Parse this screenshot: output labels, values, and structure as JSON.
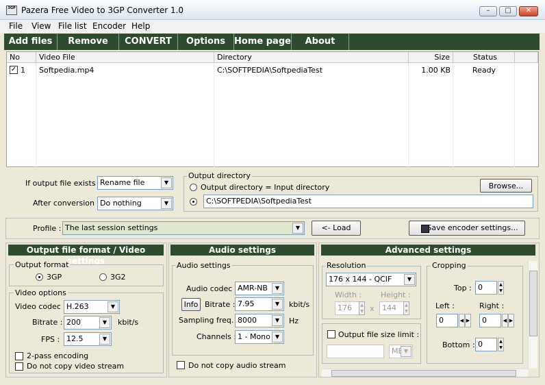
{
  "window": {
    "title": "Pazera Free Video to 3GP Converter 1.0",
    "icon_text": "3GP"
  },
  "menu": [
    "File",
    "View",
    "File list",
    "Encoder",
    "Help"
  ],
  "toolbar": [
    "Add files",
    "Remove",
    "CONVERT",
    "Options",
    "Home page",
    "About"
  ],
  "file_list": {
    "headers": [
      "No",
      "Video File",
      "Directory",
      "Size",
      "Status"
    ],
    "rows": [
      {
        "no": "1",
        "file": "Softpedia.mp4",
        "directory": "C:\\SOFTPEDIA\\SoftpediaTest",
        "size": "1.00 KB",
        "status": "Ready",
        "checked": true
      }
    ]
  },
  "output": {
    "exists_label": "If output file exists :",
    "exists_value": "Rename file",
    "after_label": "After conversion :",
    "after_value": "Do nothing",
    "dir_group": "Output directory",
    "dir_same_label": "Output directory = Input directory",
    "browse": "Browse...",
    "dir_path": "C:\\SOFTPEDIA\\SoftpediaTest"
  },
  "profile": {
    "label": "Profile :",
    "value": "The last session settings",
    "load": "<- Load",
    "save": "Save encoder settings..."
  },
  "video": {
    "section": "Output file format / Video settings",
    "format_group": "Output format",
    "formats": [
      "3GP",
      "3G2"
    ],
    "options_group": "Video options",
    "codec_label": "Video codec :",
    "codec": "H.263",
    "bitrate_label": "Bitrate :",
    "bitrate": "200",
    "bitrate_unit": "kbit/s",
    "fps_label": "FPS :",
    "fps": "12.5",
    "two_pass": "2-pass encoding",
    "no_copy": "Do not copy video stream"
  },
  "audio": {
    "section": "Audio settings",
    "group": "Audio settings",
    "codec_label": "Audio codec :",
    "codec": "AMR-NB",
    "info": "Info",
    "bitrate_label": "Bitrate :",
    "bitrate": "7.95",
    "bitrate_unit": "kbit/s",
    "freq_label": "Sampling freq. :",
    "freq": "8000",
    "freq_unit": "Hz",
    "channels_label": "Channels :",
    "channels": "1 - Mono",
    "no_copy": "Do not copy audio stream"
  },
  "advanced": {
    "section": "Advanced settings",
    "res_group": "Resolution",
    "resolution": "176 x 144 - QCIF",
    "width_label": "Width :",
    "width": "176",
    "height_label": "Height :",
    "height": "144",
    "x_sep": "x",
    "size_limit": "Output file size limit :",
    "size_unit": "MB",
    "crop_group": "Cropping",
    "top_label": "Top :",
    "top": "0",
    "left_label": "Left :",
    "left": "0",
    "right_label": "Right :",
    "right": "0",
    "bottom_label": "Bottom :",
    "bottom": "0"
  },
  "colors": {
    "toolbar_bg": "#2e4a2f",
    "section_bg": "#2e4a2f",
    "face": "#ece9d8"
  }
}
